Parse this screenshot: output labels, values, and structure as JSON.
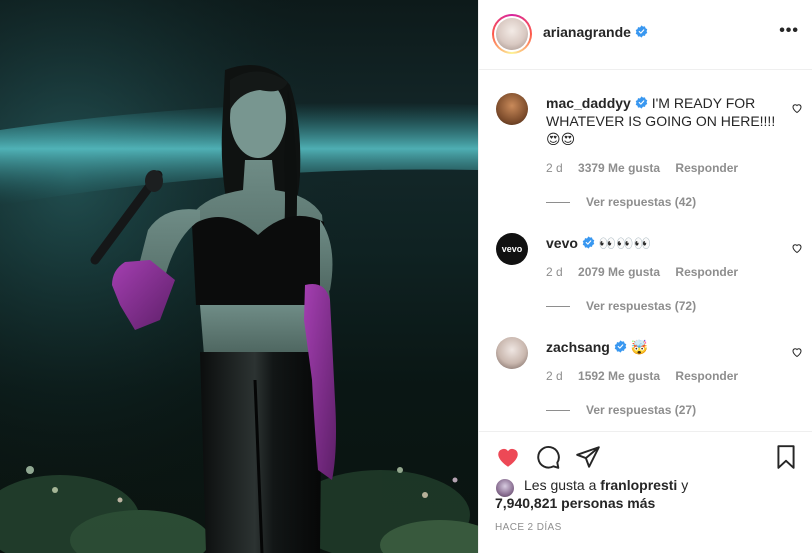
{
  "post": {
    "author": "arianagrande",
    "author_verified": true,
    "more_icon": "more-dots-icon",
    "photo_description_icon": "concert-photo"
  },
  "comments": [
    {
      "user": "mac_daddyy",
      "verified": true,
      "text": "I'M READY FOR WHATEVER IS GOING ON HERE!!!! 😍😍",
      "time": "2 d",
      "likes": "3379 Me gusta",
      "reply": "Responder",
      "view_replies": "Ver respuestas (42)"
    },
    {
      "user": "vevo",
      "verified": true,
      "text": "👀👀👀",
      "time": "2 d",
      "likes": "2079 Me gusta",
      "reply": "Responder",
      "view_replies": "Ver respuestas (72)"
    },
    {
      "user": "zachsang",
      "verified": true,
      "text": "🤯",
      "time": "2 d",
      "likes": "1592 Me gusta",
      "reply": "Responder",
      "view_replies": "Ver respuestas (27)"
    }
  ],
  "likes_line": {
    "prefix": "Les gusta a",
    "user": "franlopresti",
    "conj": "y",
    "others": "7,940,821 personas más"
  },
  "timestamp": "Hace 2 días",
  "colors": {
    "like_red": "#ed4956",
    "verified_blue": "#3897f0",
    "secondary_text": "#8e8e8e"
  }
}
